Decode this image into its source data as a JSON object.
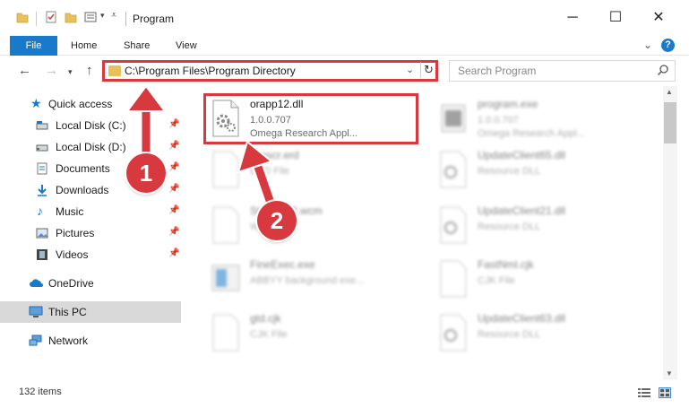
{
  "window": {
    "title": "Program",
    "controls": {
      "minimize": "─",
      "maximize": "☐",
      "close": "✕"
    }
  },
  "ribbon": {
    "tabs": [
      "File",
      "Home",
      "Share",
      "View"
    ],
    "expand_icon": "chevron-down-icon",
    "help_label": "?"
  },
  "address_bar": {
    "path": "C:\\Program Files\\Program Directory",
    "highlight_color": "#d8393f"
  },
  "search": {
    "placeholder": "Search Program"
  },
  "sidebar": {
    "items": [
      {
        "label": "Quick access",
        "icon": "star-icon",
        "pinned": false
      },
      {
        "label": "Local Disk (C:)",
        "icon": "drive-icon",
        "pinned": true
      },
      {
        "label": "Local Disk (D:)",
        "icon": "drive-icon",
        "pinned": true
      },
      {
        "label": "Documents",
        "icon": "documents-icon",
        "pinned": true
      },
      {
        "label": "Downloads",
        "icon": "download-icon",
        "pinned": true
      },
      {
        "label": "Music",
        "icon": "music-icon",
        "pinned": true
      },
      {
        "label": "Pictures",
        "icon": "pictures-icon",
        "pinned": true
      },
      {
        "label": "Videos",
        "icon": "videos-icon",
        "pinned": true
      },
      {
        "label": "OneDrive",
        "icon": "cloud-icon",
        "pinned": false
      },
      {
        "label": "This PC",
        "icon": "computer-icon",
        "pinned": false,
        "selected": true
      },
      {
        "label": "Network",
        "icon": "network-icon",
        "pinned": false
      }
    ]
  },
  "files": [
    {
      "name": "orapp12.dll",
      "line2": "1.0.0.707",
      "line3": "Omega Research Appl...",
      "icon": "gear-file-icon",
      "highlighted": true
    },
    {
      "name": "program.exe",
      "line2": "1.0.0.707",
      "line3": "Omega Research Appl...",
      "icon": "app-icon"
    },
    {
      "name": "Prescr.erd",
      "line2": "ERD File",
      "line3": "",
      "icon": "blank-file-icon"
    },
    {
      "name": "UpdateClient65.dll",
      "line2": "Resource DLL",
      "line3": "",
      "icon": "gear-file-icon"
    },
    {
      "name": "Std10P12.wcm",
      "line2": "WCM File",
      "line3": "",
      "icon": "blank-file-icon"
    },
    {
      "name": "UpdateClient21.dll",
      "line2": "Resource DLL",
      "line3": "",
      "icon": "gear-file-icon"
    },
    {
      "name": "FineExec.exe",
      "line2": "ABBYY background exe...",
      "line3": "",
      "icon": "app-icon"
    },
    {
      "name": "FastNml.cjk",
      "line2": "CJK File",
      "line3": "",
      "icon": "blank-file-icon"
    },
    {
      "name": "gtd.cjk",
      "line2": "CJK File",
      "line3": "",
      "icon": "blank-file-icon"
    },
    {
      "name": "UpdateClient63.dll",
      "line2": "Resource DLL",
      "line3": "",
      "icon": "gear-file-icon"
    }
  ],
  "status": {
    "item_count": "132 items"
  },
  "callouts": [
    {
      "number": "1",
      "color": "#d8393f"
    },
    {
      "number": "2",
      "color": "#d8393f"
    }
  ]
}
